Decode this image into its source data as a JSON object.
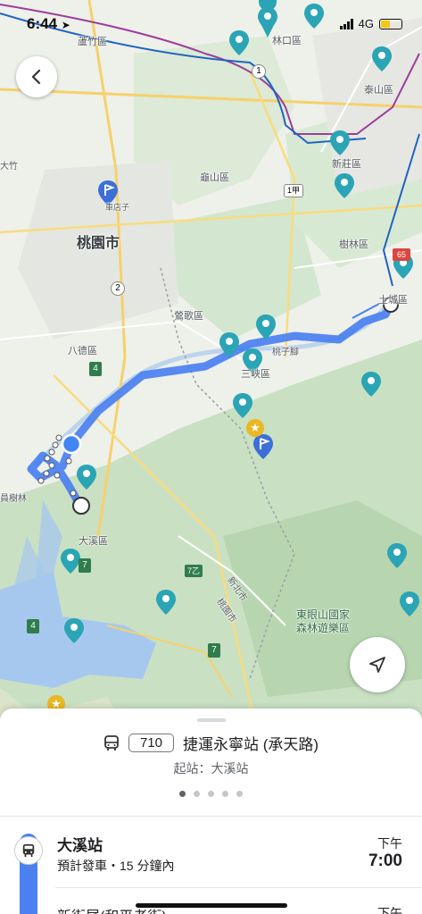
{
  "status": {
    "time": "6:44",
    "network": "4G"
  },
  "map": {
    "labels": {
      "luzhu": "蘆竹區",
      "linkou": "林口區",
      "taishan": "泰山區",
      "xinzhuang": "新莊區",
      "guishan": "龜山區",
      "chediancun": "車店子",
      "taoyuan_city": "桃園市",
      "shulin": "樹林區",
      "yingge": "鶯歌區",
      "bade": "八德區",
      "sanxia": "三峽區",
      "taozixiao": "桃子腳",
      "daxi": "大溪區",
      "longtan": "員樹林",
      "tucheng": "土城區",
      "dayuan": "大竹",
      "dongyan": "東眼山國家\n森林遊樂區",
      "xinbei": "新北市",
      "taoyuan_border": "桃園市",
      "xingmu": "興"
    },
    "road_numbers": [
      "1",
      "1甲",
      "2",
      "4",
      "4",
      "7",
      "7乙",
      "7",
      "65"
    ]
  },
  "sheet": {
    "route_number": "710",
    "destination": "捷運永寧站 (承天路)",
    "start": "起站：大溪站",
    "page_count": 5,
    "active_page": 0
  },
  "stops": [
    {
      "name": "大溪站",
      "sub": "預計發車・15 分鐘內",
      "ampm": "下午",
      "time": "7:00"
    },
    {
      "name": "新街尾(和平老街)",
      "ampm": "下午"
    }
  ],
  "colors": {
    "route": "#4a80f0",
    "accent": "#1a73e8"
  }
}
